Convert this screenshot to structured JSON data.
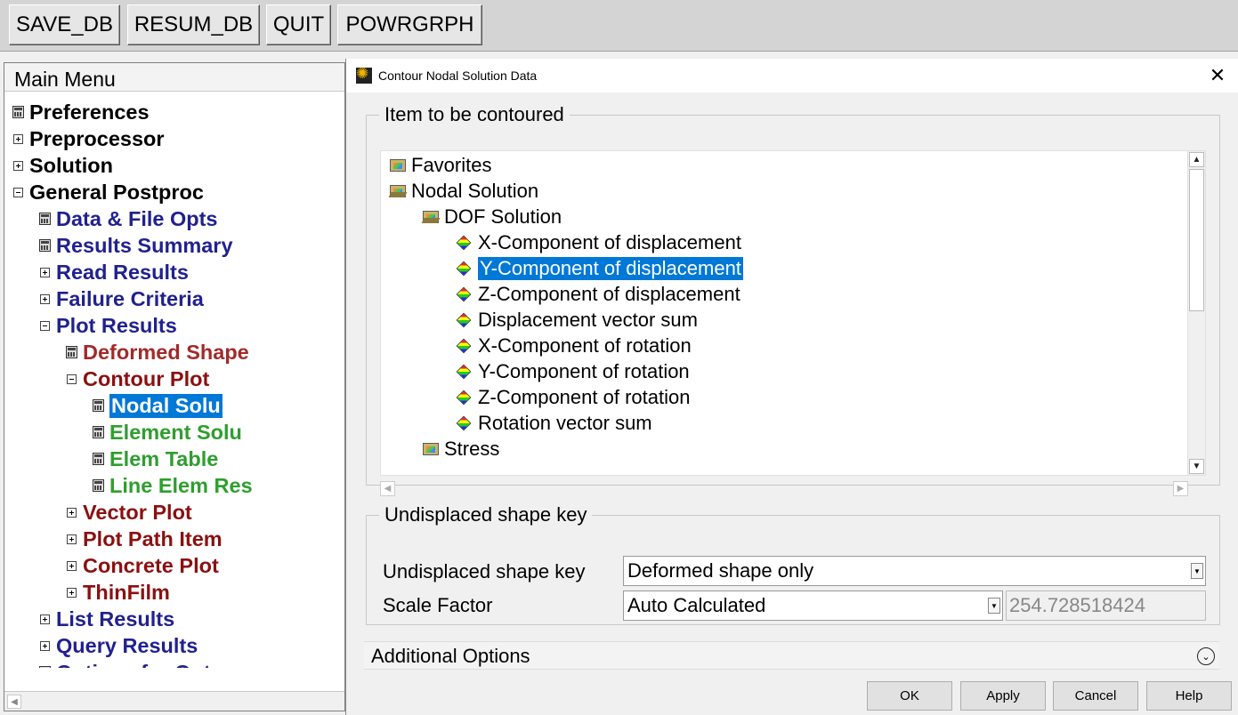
{
  "toolbar": {
    "buttons": [
      "SAVE_DB",
      "RESUM_DB",
      "QUIT",
      "POWRGRPH"
    ]
  },
  "main_menu": {
    "header": "Main Menu",
    "items": [
      {
        "label": "Preferences",
        "icon": "calculator-icon"
      },
      {
        "label": "Preprocessor",
        "icon": "expand-plus-icon"
      },
      {
        "label": "Solution",
        "icon": "expand-plus-icon"
      },
      {
        "label": "General Postproc",
        "icon": "collapse-minus-icon"
      },
      {
        "label": "Data & File Opts",
        "icon": "calculator-icon"
      },
      {
        "label": "Results Summary",
        "icon": "calculator-icon"
      },
      {
        "label": "Read Results",
        "icon": "expand-plus-icon"
      },
      {
        "label": "Failure Criteria",
        "icon": "expand-plus-icon"
      },
      {
        "label": "Plot Results",
        "icon": "collapse-minus-icon"
      },
      {
        "label": "Deformed Shape",
        "icon": "calculator-icon"
      },
      {
        "label": "Contour Plot",
        "icon": "collapse-minus-icon"
      },
      {
        "label": "Nodal Solu",
        "icon": "calculator-icon",
        "selected": true
      },
      {
        "label": "Element Solu",
        "icon": "calculator-icon"
      },
      {
        "label": "Elem Table",
        "icon": "calculator-icon"
      },
      {
        "label": "Line Elem Res",
        "icon": "calculator-icon"
      },
      {
        "label": "Vector Plot",
        "icon": "expand-plus-icon"
      },
      {
        "label": "Plot Path Item",
        "icon": "expand-plus-icon"
      },
      {
        "label": "Concrete Plot",
        "icon": "expand-plus-icon"
      },
      {
        "label": "ThinFilm",
        "icon": "expand-plus-icon"
      },
      {
        "label": "List Results",
        "icon": "expand-plus-icon"
      },
      {
        "label": "Query Results",
        "icon": "expand-plus-icon"
      },
      {
        "label": "Options for Outp",
        "icon": "calculator-icon"
      }
    ],
    "colors": {
      "black": "#000000",
      "navy": "#21218e",
      "red": "#a22a2a",
      "maroon": "#8b1010",
      "green": "#2e9e2e",
      "selection": "#0078d7"
    }
  },
  "dialog": {
    "title": "Contour Nodal Solution Data",
    "close_icon": "close-icon",
    "item_group": {
      "legend": "Item to be contoured",
      "tree": [
        {
          "label": "Favorites",
          "icon": "folder-icon"
        },
        {
          "label": "Nodal Solution",
          "icon": "folder-open-icon"
        },
        {
          "label": "DOF Solution",
          "icon": "folder-open-icon"
        },
        {
          "label": "X-Component of displacement",
          "icon": "cube-icon"
        },
        {
          "label": "Y-Component of displacement",
          "icon": "cube-icon",
          "selected": true
        },
        {
          "label": "Z-Component of displacement",
          "icon": "cube-icon"
        },
        {
          "label": "Displacement vector sum",
          "icon": "cube-icon"
        },
        {
          "label": "X-Component of rotation",
          "icon": "cube-icon"
        },
        {
          "label": "Y-Component of rotation",
          "icon": "cube-icon"
        },
        {
          "label": "Z-Component of rotation",
          "icon": "cube-icon"
        },
        {
          "label": "Rotation vector sum",
          "icon": "cube-icon"
        },
        {
          "label": "Stress",
          "icon": "folder-icon"
        }
      ]
    },
    "undisplaced_group": {
      "legend": "Undisplaced shape key",
      "shape_key_label": "Undisplaced shape key",
      "shape_key_value": "Deformed shape only",
      "scale_label": "Scale Factor",
      "scale_value": "Auto Calculated",
      "scale_number": "254.728518424"
    },
    "additional_options": "Additional Options",
    "buttons": {
      "ok": "OK",
      "apply": "Apply",
      "cancel": "Cancel",
      "help": "Help"
    }
  }
}
